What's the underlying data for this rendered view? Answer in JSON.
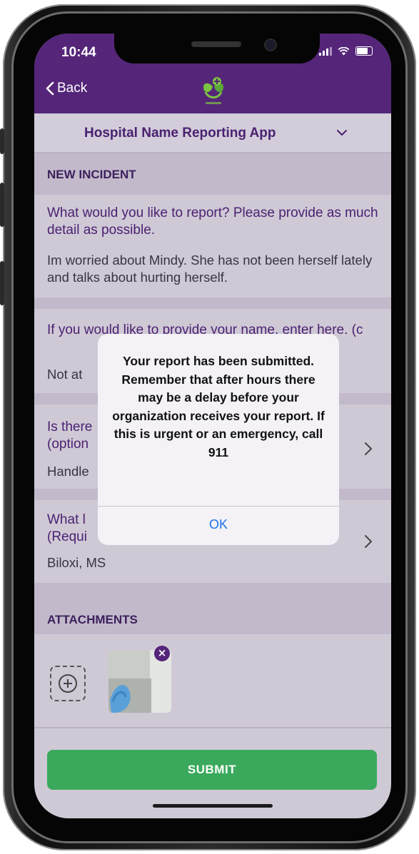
{
  "status_bar": {
    "time": "10:44"
  },
  "nav": {
    "back_label": "Back"
  },
  "selector": {
    "title": "Hospital Name Reporting App"
  },
  "new_incident": {
    "header": "NEW INCIDENT",
    "question1": "What would you like to report? Please provide as much detail as possible.",
    "answer1": "Im worried about Mindy. She has not been herself lately and talks about hurting herself.",
    "question2": "If you would like to provide your name, enter here. (c",
    "answer2": "Not at",
    "question3_line1": "Is there",
    "question3_line2": "(option",
    "answer3": "Handle",
    "question4_line1": "What l",
    "question4_line2": "(Requi",
    "answer4": "Biloxi, MS"
  },
  "attachments": {
    "header": "ATTACHMENTS"
  },
  "submit": {
    "label": "SUBMIT"
  },
  "dialog": {
    "message": "Your report has been submitted. Remember that after hours there may be a delay before your organization receives your report. If this is urgent or an emergency, call 911",
    "ok_label": "OK"
  },
  "colors": {
    "brand_purple": "#542579",
    "submit_green": "#3aa95c",
    "link_blue": "#1a73e8"
  }
}
